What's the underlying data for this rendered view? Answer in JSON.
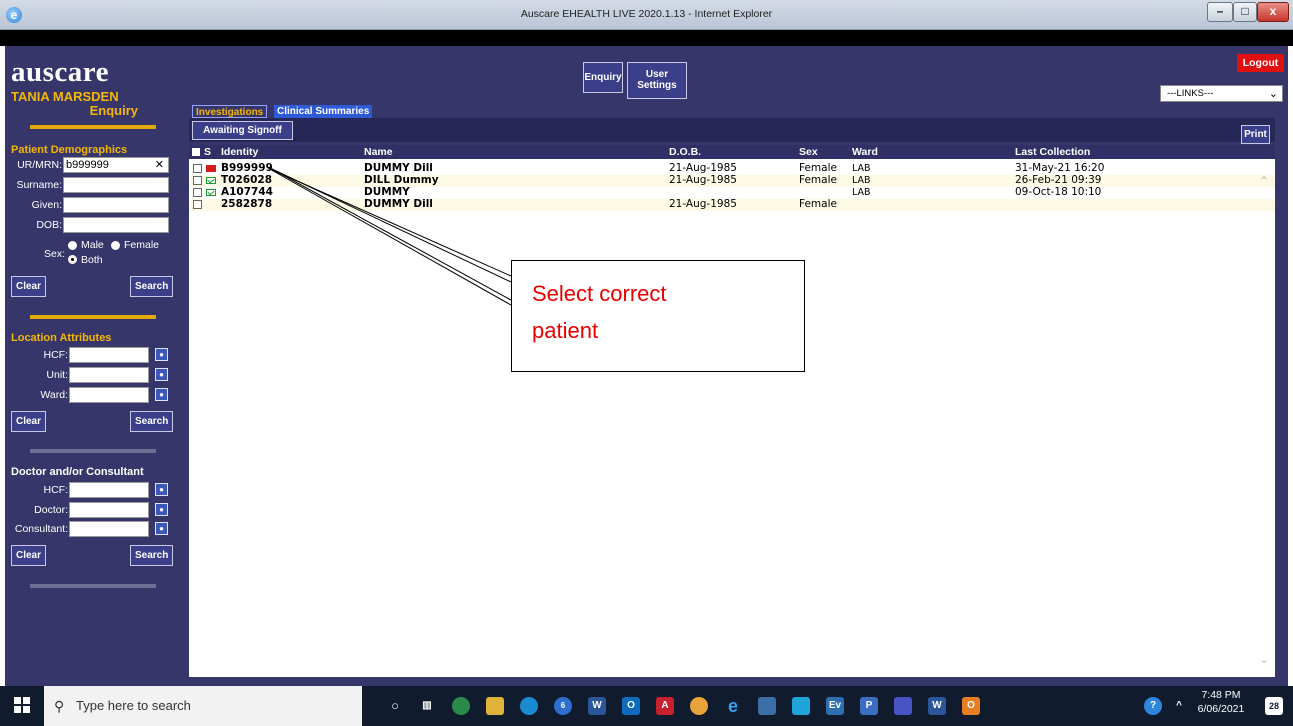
{
  "window": {
    "title": "Auscare EHEALTH LIVE 2020.1.13 - Internet Explorer",
    "min_label": "–",
    "max_label": "□",
    "close_label": "x"
  },
  "app": {
    "logo": "auscare",
    "user_name": "TANIA MARSDEN",
    "mode": "Enquiry"
  },
  "toolbar": {
    "enquiry_label": "Enquiry",
    "user_settings_label_1": "User",
    "user_settings_label_2": "Settings",
    "logout_label": "Logout",
    "links_value": "---LINKS---"
  },
  "patient_demographics": {
    "heading": "Patient Demographics",
    "urmrn_label": "UR/MRN:",
    "urmrn_value": "b999999",
    "clear_x": "✕",
    "surname_label": "Surname:",
    "given_label": "Given:",
    "dob_label": "DOB:",
    "sex_label": "Sex:",
    "sex_options": [
      "Male",
      "Female",
      "Both"
    ],
    "sex_selected": "Both",
    "clear_label": "Clear",
    "search_label": "Search"
  },
  "location_attributes": {
    "heading": "Location Attributes",
    "hcf_label": "HCF:",
    "unit_label": "Unit:",
    "ward_label": "Ward:",
    "clear_label": "Clear",
    "search_label": "Search"
  },
  "doctor_consultant": {
    "heading": "Doctor and/or Consultant",
    "hcf_label": "HCF:",
    "doctor_label": "Doctor:",
    "consultant_label": "Consultant:",
    "clear_label": "Clear",
    "search_label": "Search"
  },
  "tabs": [
    {
      "label": "Investigations",
      "active": true
    },
    {
      "label": "Clinical Summaries",
      "active": false
    }
  ],
  "subtoolbar": {
    "awaiting_label": "Awaiting Signoff",
    "print_label": "Print"
  },
  "table": {
    "headers": {
      "s": "S",
      "identity": "Identity",
      "name": "Name",
      "dob": "D.O.B.",
      "sex": "Sex",
      "ward": "Ward",
      "last_collection": "Last Collection"
    },
    "rows": [
      {
        "status": "red",
        "identity": "B999999",
        "name": "DUMMY Dill",
        "dob": "21-Aug-1985",
        "sex": "Female",
        "ward": "LAB",
        "last_collection": "31-May-21 16:20"
      },
      {
        "status": "green",
        "identity": "T026028",
        "name": "DILL Dummy",
        "dob": "21-Aug-1985",
        "sex": "Female",
        "ward": "LAB",
        "last_collection": "26-Feb-21 09:39"
      },
      {
        "status": "green",
        "identity": "A107744",
        "name": "DUMMY",
        "dob": "",
        "sex": "",
        "ward": "LAB",
        "last_collection": "09-Oct-18 10:10"
      },
      {
        "status": "none",
        "identity": "2582878",
        "name": "DUMMY Dill",
        "dob": "21-Aug-1985",
        "sex": "Female",
        "ward": "",
        "last_collection": ""
      }
    ]
  },
  "callout": {
    "line1": "Select correct",
    "line2": "patient"
  },
  "taskbar": {
    "search_placeholder": "Type here to search",
    "time": "7:48 PM",
    "date": "6/06/2021",
    "notification_count": "28",
    "badge_count": "6"
  },
  "colors": {
    "app_bg": "#37366b",
    "gold": "#f5b700",
    "logout_red": "#e01010",
    "callout_red": "#e80000"
  }
}
